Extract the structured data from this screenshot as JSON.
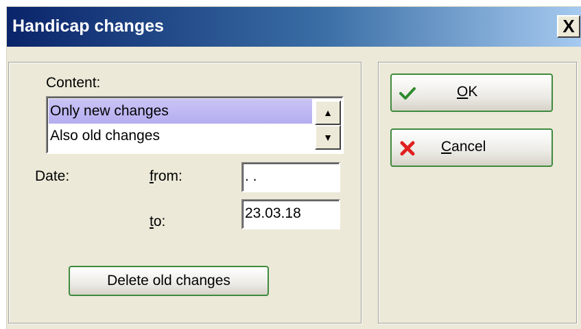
{
  "window": {
    "title": "Handicap changes",
    "close_label": "X"
  },
  "content": {
    "label": "Content:",
    "options": [
      "Only new changes",
      "Also old changes"
    ],
    "selected_index": 0,
    "scroll_up_symbol": "▲",
    "scroll_down_symbol": "▼"
  },
  "date": {
    "label": "Date:",
    "from_accel": "f",
    "from_rest": "rom:",
    "from_value": " . .",
    "to_accel": "t",
    "to_rest": "o:",
    "to_value": "23.03.18"
  },
  "buttons": {
    "delete_label": "Delete old changes",
    "ok_accel": "O",
    "ok_rest": "K",
    "cancel_accel": "C",
    "cancel_rest": "ancel"
  },
  "colors": {
    "check_icon": "#2e8b2e",
    "cancel_icon": "#e02020",
    "button_border": "#3d8a3d"
  },
  "icons": {
    "ok": "checkmark-icon",
    "cancel": "red-x-icon"
  }
}
